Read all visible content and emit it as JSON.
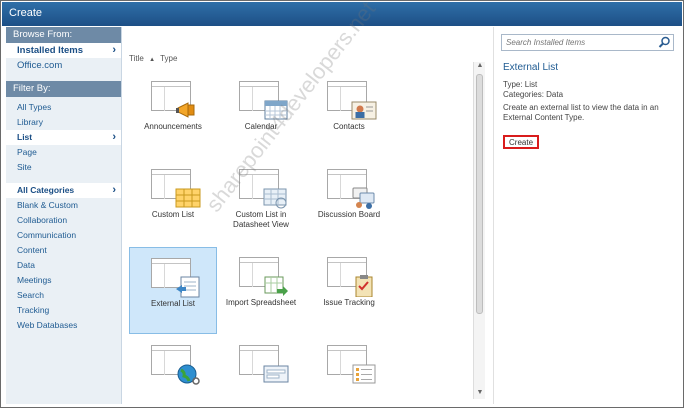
{
  "window": {
    "title": "Create"
  },
  "sidebar": {
    "browse_header": "Browse From:",
    "browse_items": [
      {
        "label": "Installed Items",
        "selected": true
      },
      {
        "label": "Office.com",
        "selected": false
      }
    ],
    "filter_header": "Filter By:",
    "type_filters": [
      {
        "label": "All Types",
        "selected": false
      },
      {
        "label": "Library",
        "selected": false
      },
      {
        "label": "List",
        "selected": true
      },
      {
        "label": "Page",
        "selected": false
      },
      {
        "label": "Site",
        "selected": false
      }
    ],
    "category_filters": [
      {
        "label": "All Categories",
        "selected": true
      },
      {
        "label": "Blank & Custom"
      },
      {
        "label": "Collaboration"
      },
      {
        "label": "Communication"
      },
      {
        "label": "Content"
      },
      {
        "label": "Data"
      },
      {
        "label": "Meetings"
      },
      {
        "label": "Search"
      },
      {
        "label": "Tracking"
      },
      {
        "label": "Web Databases"
      }
    ]
  },
  "main": {
    "sort": {
      "title_label": "Title",
      "sort_indicator": "▲",
      "type_label": "Type"
    },
    "tiles": [
      {
        "label": "Announcements",
        "icon": "megaphone-icon"
      },
      {
        "label": "Calendar",
        "icon": "calendar-icon"
      },
      {
        "label": "Contacts",
        "icon": "contact-card-icon"
      },
      {
        "label": "Custom List",
        "icon": "table-icon"
      },
      {
        "label": "Custom List in Datasheet View",
        "icon": "datasheet-icon"
      },
      {
        "label": "Discussion Board",
        "icon": "discussion-icon"
      },
      {
        "label": "External List",
        "icon": "external-list-icon",
        "selected": true
      },
      {
        "label": "Import Spreadsheet",
        "icon": "import-spreadsheet-icon"
      },
      {
        "label": "Issue Tracking",
        "icon": "clipboard-icon"
      },
      {
        "label": "",
        "icon": "globe-icon"
      },
      {
        "label": "",
        "icon": "form-icon"
      },
      {
        "label": "",
        "icon": "list-items-icon"
      }
    ]
  },
  "detail": {
    "search_placeholder": "Search Installed Items",
    "title": "External List",
    "type_line": "Type: List",
    "categories_line": "Categories: Data",
    "description": "Create an external list to view the data in an External Content Type.",
    "create_label": "Create"
  },
  "watermark": "sharepoint4developers.net",
  "colors": {
    "title_bar": "#1d4f86",
    "section_header": "#6e8aa6",
    "link": "#1f5b92",
    "selected_tile": "#cfe7fa",
    "create_highlight": "#d91c1c"
  }
}
